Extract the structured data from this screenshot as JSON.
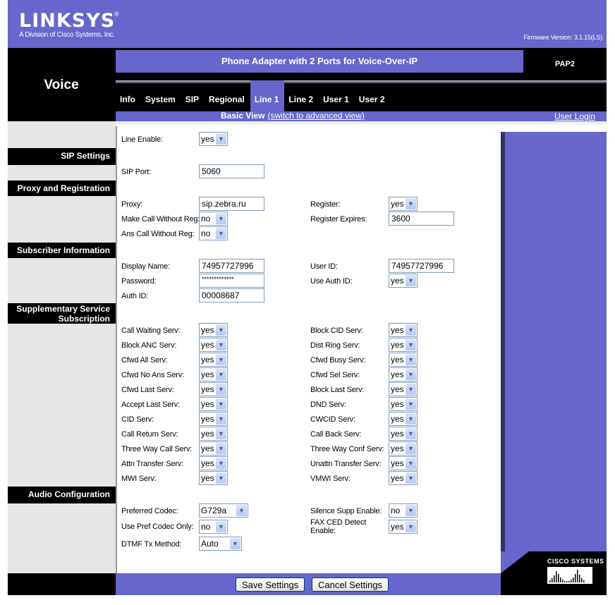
{
  "header": {
    "brand": "LINKSYS",
    "brand_sub": "A Division of Cisco Systems, Inc.",
    "firmware": "Firmware Version: 3.1.15(LS)",
    "section_title": "Voice",
    "product_title": "Phone Adapter with 2 Ports for Voice-Over-IP",
    "model": "PAP2",
    "view_label": "Basic View",
    "advanced_link": "(switch to advanced view)",
    "user_login": "User Login"
  },
  "tabs": [
    {
      "label": "Info",
      "active": false
    },
    {
      "label": "System",
      "active": false
    },
    {
      "label": "SIP",
      "active": false
    },
    {
      "label": "Regional",
      "active": false
    },
    {
      "label": "Line 1",
      "active": true
    },
    {
      "label": "Line 2",
      "active": false
    },
    {
      "label": "User 1",
      "active": false
    },
    {
      "label": "User 2",
      "active": false
    }
  ],
  "sections": {
    "sip": "SIP Settings",
    "proxy": "Proxy and Registration",
    "subscriber": "Subscriber Information",
    "supp_1": "Supplementary Service",
    "supp_2": "Subscription",
    "audio": "Audio Configuration"
  },
  "fields": {
    "line_enable": {
      "label": "Line Enable:",
      "value": "yes"
    },
    "sip_port": {
      "label": "SIP Port:",
      "value": "5060"
    },
    "proxy": {
      "label": "Proxy:",
      "value": "sip.zebra.ru"
    },
    "register": {
      "label": "Register:",
      "value": "yes"
    },
    "make_call_without_reg": {
      "label": "Make Call Without Reg:",
      "value": "no"
    },
    "register_expires": {
      "label": "Register Expires:",
      "value": "3600"
    },
    "ans_call_without_reg": {
      "label": "Ans Call Without Reg:",
      "value": "no"
    },
    "display_name": {
      "label": "Display Name:",
      "value": "74957727996"
    },
    "user_id": {
      "label": "User ID:",
      "value": "74957727996"
    },
    "password": {
      "label": "Password:",
      "value": "*************"
    },
    "use_auth_id": {
      "label": "Use Auth ID:",
      "value": "yes"
    },
    "auth_id": {
      "label": "Auth ID:",
      "value": "00008687"
    },
    "preferred_codec": {
      "label": "Preferred Codec:",
      "value": "G729a"
    },
    "silence_supp": {
      "label": "Silence Supp Enable:",
      "value": "no"
    },
    "use_pref_codec_only": {
      "label": "Use Pref Codec Only:",
      "value": "no"
    },
    "fax_ced_1": {
      "label": "FAX CED Detect",
      "value": "yes"
    },
    "fax_ced_2": {
      "label": "Enable:"
    },
    "dtmf_tx": {
      "label": "DTMF Tx Method:",
      "value": "Auto"
    }
  },
  "services_left": [
    {
      "label": "Call Waiting Serv:",
      "value": "yes"
    },
    {
      "label": "Block ANC Serv:",
      "value": "yes"
    },
    {
      "label": "Cfwd All Serv:",
      "value": "yes"
    },
    {
      "label": "Cfwd No Ans Serv:",
      "value": "yes"
    },
    {
      "label": "Cfwd Last Serv:",
      "value": "yes"
    },
    {
      "label": "Accept Last Serv:",
      "value": "yes"
    },
    {
      "label": "CID Serv:",
      "value": "yes"
    },
    {
      "label": "Call Return Serv:",
      "value": "yes"
    },
    {
      "label": "Three Way Call Serv:",
      "value": "yes"
    },
    {
      "label": "Attn Transfer Serv:",
      "value": "yes"
    },
    {
      "label": "MWI Serv:",
      "value": "yes"
    }
  ],
  "services_right": [
    {
      "label": "Block CID Serv:",
      "value": "yes"
    },
    {
      "label": "Dist Ring Serv:",
      "value": "yes"
    },
    {
      "label": "Cfwd Busy Serv:",
      "value": "yes"
    },
    {
      "label": "Cfwd Sel Serv:",
      "value": "yes"
    },
    {
      "label": "Block Last Serv:",
      "value": "yes"
    },
    {
      "label": "DND Serv:",
      "value": "yes"
    },
    {
      "label": "CWCID Serv:",
      "value": "yes"
    },
    {
      "label": "Call Back Serv:",
      "value": "yes"
    },
    {
      "label": "Three Way Conf Serv:",
      "value": "yes"
    },
    {
      "label": "Unattn Transfer Serv:",
      "value": "yes"
    },
    {
      "label": "VMWI Serv:",
      "value": "yes"
    }
  ],
  "buttons": {
    "save": "Save Settings",
    "cancel": "Cancel Settings"
  },
  "footer": {
    "cisco": "CISCO SYSTEMS"
  },
  "colors": {
    "brand_purple": "#6666cc",
    "black": "#000000",
    "panel_grey": "#e6e6e6"
  }
}
